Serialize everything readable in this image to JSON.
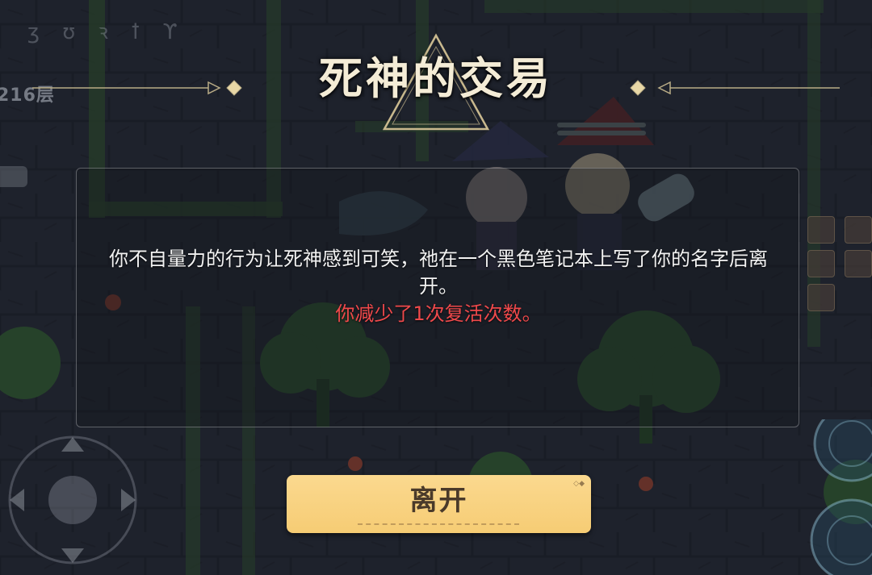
{
  "hud": {
    "floor_label": "216层",
    "runes": "ʒ ʊ ꝛ ꝉ ϒ"
  },
  "dialog": {
    "title": "死神的交易",
    "message": "你不自量力的行为让死神感到可笑，祂在一个黑色笔记本上写了你的名字后离开。",
    "penalty": "你减少了1次复活次数。"
  },
  "actions": {
    "leave_label": "离开"
  },
  "colors": {
    "title_text": "#f4ecd6",
    "penalty_text": "#f0494b",
    "button_fill": "#f6cc74",
    "button_text": "#4a3a2a",
    "dialog_border": "#b4b4b9"
  },
  "icons": {
    "joystick": "directional-pad-icon",
    "skill": "skill-rune-icon",
    "title_ornament": "triangle-ornament-icon",
    "divider": "diamond-arrow-icon"
  }
}
